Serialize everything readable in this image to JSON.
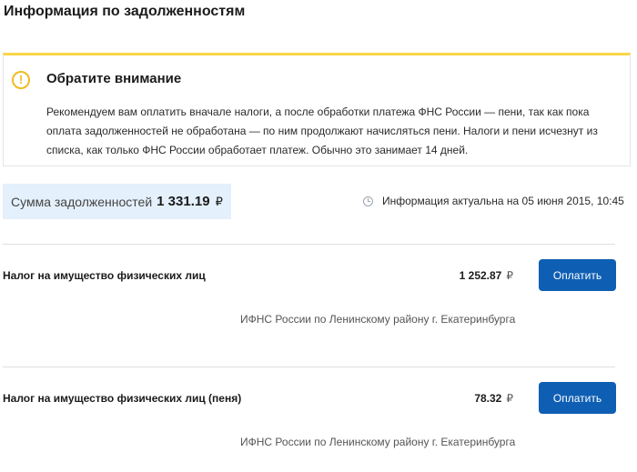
{
  "page": {
    "title": "Информация по задолженностям"
  },
  "notice": {
    "icon": "exclamation-icon",
    "title": "Обратите внимание",
    "text": "Рекомендуем вам оплатить вначале налоги, а после обработки платежа ФНС России — пени, так как пока оплата задолженностей не обработана — по ним продолжают начисляться пени. Налоги и пени исчезнут из списка, как только ФНС России обработает платеж. Обычно это занимает 14 дней.",
    "accent_color": "#f9d648"
  },
  "summary": {
    "label": "Сумма задолженностей",
    "amount": "1 331.19",
    "currency": "₽",
    "updated_text": "Информация актуальна на 05 июня 2015, 10:45",
    "updated_icon": "clock-icon"
  },
  "debts": [
    {
      "name": "Налог на имущество физических лиц",
      "amount": "1 252.87",
      "currency": "₽",
      "pay_label": "Оплатить",
      "organization": "ИФНС России по Ленинскому району г. Екатеринбурга"
    },
    {
      "name": "Налог на имущество физических лиц (пеня)",
      "amount": "78.32",
      "currency": "₽",
      "pay_label": "Оплатить",
      "organization": "ИФНС России по Ленинскому району г. Екатеринбурга"
    }
  ],
  "colors": {
    "primary_button": "#0e5fb4",
    "summary_background": "#e4f0fb"
  }
}
